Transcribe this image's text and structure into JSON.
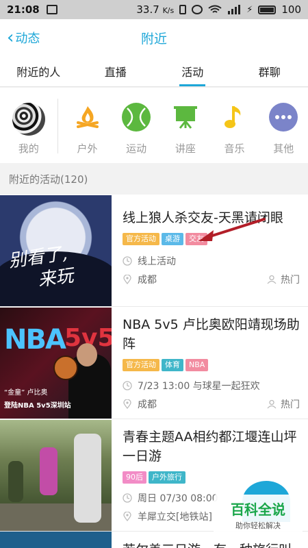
{
  "status_bar": {
    "time": "21:08",
    "speed": "33.7",
    "speed_unit": "K/s",
    "battery": "100"
  },
  "header": {
    "back_label": "动态",
    "title": "附近"
  },
  "tabs": [
    {
      "label": "附近的人",
      "active": false
    },
    {
      "label": "直播",
      "active": false
    },
    {
      "label": "活动",
      "active": true
    },
    {
      "label": "群聊",
      "active": false
    }
  ],
  "categories": [
    {
      "label": "我的",
      "icon": "avatar-icon"
    },
    {
      "label": "户外",
      "icon": "campfire-icon"
    },
    {
      "label": "运动",
      "icon": "tennis-ball-icon"
    },
    {
      "label": "讲座",
      "icon": "presentation-board-icon"
    },
    {
      "label": "音乐",
      "icon": "music-note-icon"
    },
    {
      "label": "其他",
      "icon": "more-dots-icon"
    }
  ],
  "section_title": "附近的活动(120)",
  "activities": [
    {
      "title": "线上狼人杀交友-天黑请闭眼",
      "tags": [
        {
          "label": "官方活动",
          "color": "#f5b84a"
        },
        {
          "label": "桌游",
          "color": "#5bb9e8"
        },
        {
          "label": "交友",
          "color": "#f28ca0"
        }
      ],
      "time": "线上活动",
      "location": "成都",
      "popularity": "热门",
      "thumb_text": [
        "别看了,",
        "来玩"
      ]
    },
    {
      "title": "NBA 5v5 卢比奥欧阳靖现场助阵",
      "tags": [
        {
          "label": "官方活动",
          "color": "#f5b84a"
        },
        {
          "label": "体育",
          "color": "#3fb6c9"
        },
        {
          "label": "NBA",
          "color": "#f28ca0"
        }
      ],
      "time": "7/23 13:00 与球星一起狂欢",
      "location": "成都",
      "popularity": "热门",
      "thumb_text": [
        "NBA",
        "5v5",
        "“金童” 卢比奥",
        "登陆NBA 5v5深圳站"
      ]
    },
    {
      "title": "青春主题AA相约都江堰连山坪一日游",
      "tags": [
        {
          "label": "90后",
          "color": "#f28cc6"
        },
        {
          "label": "户外旅行",
          "color": "#3fb6c9"
        }
      ],
      "time": "周日 07/30 08:00",
      "location": "羊犀立交[地铁站]",
      "popularity": "",
      "thumb_text": []
    }
  ],
  "peek_title": "若尔盖三日游，有一种旅行叫",
  "watermark": {
    "brand": "百科全说",
    "slogan": "助你轻松解决"
  },
  "colors": {
    "accent": "#1ea7d8",
    "orange": "#f5a623",
    "green": "#5cb83f",
    "yellow": "#f5c518",
    "purple": "#7b84c9"
  }
}
